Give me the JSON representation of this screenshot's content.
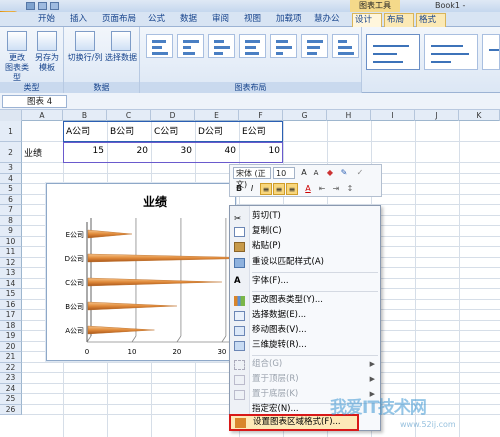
{
  "window": {
    "contextual_title": "图表工具",
    "book": "Book1 -"
  },
  "tabs": [
    {
      "label": "开始"
    },
    {
      "label": "插入"
    },
    {
      "label": "页面布局"
    },
    {
      "label": "公式"
    },
    {
      "label": "数据"
    },
    {
      "label": "审阅"
    },
    {
      "label": "视图"
    },
    {
      "label": "加载项"
    },
    {
      "label": "慧办公"
    },
    {
      "label": "设计"
    },
    {
      "label": "布局"
    },
    {
      "label": "格式"
    }
  ],
  "ribbon": {
    "type_group": {
      "label": "类型",
      "change_type": "更改\n图表类型",
      "save_template": "另存为\n模板"
    },
    "data_group": {
      "label": "数据",
      "switch": "切换行/列",
      "select": "选择数据"
    },
    "layout_group": {
      "label": "图表布局"
    }
  },
  "namebox": {
    "value": "图表 4"
  },
  "columns": [
    "A",
    "B",
    "C",
    "D",
    "E",
    "F",
    "G",
    "H",
    "I",
    "J",
    "K"
  ],
  "rows": [
    "1",
    "2",
    "3",
    "4",
    "5",
    "6",
    "7",
    "8",
    "9",
    "10",
    "11",
    "12",
    "13",
    "14",
    "15",
    "16",
    "17",
    "18",
    "19",
    "20",
    "21",
    "22",
    "23",
    "24",
    "25",
    "26"
  ],
  "sheet": {
    "headers": [
      "A公司",
      "B公司",
      "C公司",
      "D公司",
      "E公司"
    ],
    "row_label": "业绩",
    "values": [
      "15",
      "20",
      "30",
      "40",
      "10"
    ]
  },
  "chart_data": {
    "type": "bar",
    "title": "业绩",
    "categories": [
      "A公司",
      "B公司",
      "C公司",
      "D公司",
      "E公司"
    ],
    "values": [
      15,
      20,
      30,
      40,
      10
    ],
    "xlim": [
      0,
      30
    ],
    "x_ticks": [
      "0",
      "10",
      "20",
      "30"
    ],
    "orientation": "horizontal",
    "bar_color": "#e08a3a"
  },
  "mini_toolbar": {
    "font": "宋体 (正文)",
    "size": "10"
  },
  "context_menu": [
    {
      "label": "剪切(T)",
      "icon": "scissors-icon",
      "enabled": true
    },
    {
      "label": "复制(C)",
      "icon": "copy-icon",
      "enabled": true
    },
    {
      "label": "粘贴(P)",
      "icon": "paste-icon",
      "enabled": true
    },
    {
      "label": "重设以匹配样式(A)",
      "icon": "reset-style-icon",
      "enabled": true
    },
    {
      "label": "字体(F)...",
      "icon": "font-icon",
      "enabled": true
    },
    {
      "label": "更改图表类型(Y)...",
      "icon": "chart-type-icon",
      "enabled": true
    },
    {
      "label": "选择数据(E)...",
      "icon": "select-data-icon",
      "enabled": true
    },
    {
      "label": "移动图表(V)...",
      "icon": "move-chart-icon",
      "enabled": true
    },
    {
      "label": "三维旋转(R)...",
      "icon": "rotate-3d-icon",
      "enabled": true
    },
    {
      "label": "组合(G)",
      "icon": "group-icon",
      "enabled": false,
      "submenu": true
    },
    {
      "label": "置于顶层(R)",
      "icon": "bring-front-icon",
      "enabled": false,
      "submenu": true
    },
    {
      "label": "置于底层(K)",
      "icon": "send-back-icon",
      "enabled": false,
      "submenu": true
    },
    {
      "label": "指定宏(N)...",
      "icon": "",
      "enabled": true
    },
    {
      "label": "设置图表区域格式(F)...",
      "icon": "format-chart-area-icon",
      "enabled": true,
      "highlighted": true
    }
  ],
  "watermark": {
    "text": "我爱IT技术网",
    "url": "www.52ij.com"
  }
}
